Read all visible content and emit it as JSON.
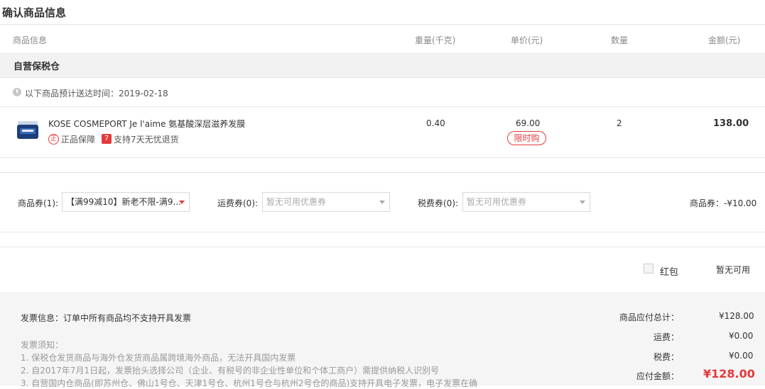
{
  "page": {
    "title": "确认商品信息"
  },
  "table": {
    "headers": {
      "product": "商品信息",
      "weight": "重量(千克)",
      "price": "单价(元)",
      "quantity": "数量",
      "amount": "金额(元)"
    }
  },
  "warehouse": {
    "name": "自营保税仓"
  },
  "delivery": {
    "text": "以下商品预计送达时间：2019-02-18"
  },
  "item": {
    "name": "KOSE COSMEPORT Je l'aime 氨基酸深层滋养发膜",
    "image_icon": "hair-mask-jar-icon",
    "badge_genuine_icon": "正",
    "badge_genuine": "正品保障",
    "badge_return_icon": "7",
    "badge_return": "支持7天无忧退货",
    "weight": "0.40",
    "unit_price": "69.00",
    "promo_tag": "限时购",
    "quantity": "2",
    "amount": "138.00"
  },
  "coupons": {
    "product_label": "商品券(1):",
    "product_selected": "【满99减10】新老不限-满9...",
    "shipping_label": "运费券(0):",
    "shipping_placeholder": "暂无可用优惠券",
    "tax_label": "税费券(0):",
    "tax_placeholder": "暂无可用优惠券",
    "discount_summary": "商品券：-¥10.00"
  },
  "red_packet": {
    "label": "红包",
    "status": "暂无可用"
  },
  "invoice": {
    "info": "发票信息：订单中所有商品均不支持开具发票",
    "notice_title": "发票须知：",
    "notes": [
      "1. 保税仓发货商品与海外仓发货商品属跨境海外商品，无法开具国内发票",
      "2. 自2017年7月1日起，发票抬头选择公司（企业、有税号的非企业性单位和个体工商户）需提供纳税人识别号",
      "3. 自营国内仓商品(即苏州仓、佛山1号仓、天津1号仓、杭州1号仓与杭州2号仓的商品)支持开具电子发票，电子发票在确"
    ]
  },
  "summary": {
    "subtotal_label": "商品应付总计：",
    "subtotal_value": "¥128.00",
    "shipping_label": "运费：",
    "shipping_value": "¥0.00",
    "tax_label": "税费：",
    "tax_value": "¥0.00",
    "total_label": "应付金额：",
    "total_value": "¥128.00"
  },
  "colors": {
    "accent": "#e4393c",
    "header_bg": "#f2f2f2",
    "footer_bg": "#f5f5f5"
  }
}
